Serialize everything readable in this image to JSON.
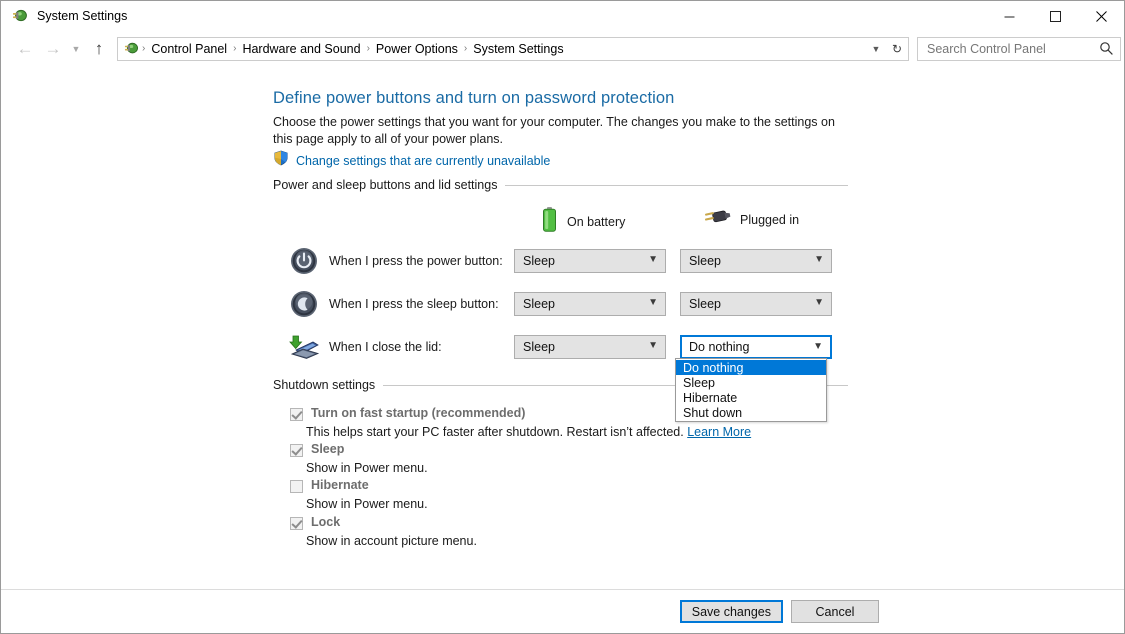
{
  "window": {
    "title": "System Settings",
    "icon": "power-plug-icon",
    "minimize_label": "Minimize",
    "maximize_label": "Maximize",
    "close_label": "Close"
  },
  "nav": {
    "back_label": "Back",
    "forward_label": "Forward",
    "recent_label": "Recent locations",
    "up_label": "Up",
    "breadcrumbs": [
      {
        "label": "Control Panel"
      },
      {
        "label": "Hardware and Sound"
      },
      {
        "label": "Power Options"
      },
      {
        "label": "System Settings"
      }
    ],
    "separator": "›",
    "refresh_label": "Refresh",
    "dropdown_label": "Previous locations"
  },
  "search": {
    "placeholder": "Search Control Panel",
    "value": "",
    "icon": "search-icon"
  },
  "page": {
    "title": "Define power buttons and turn on password protection",
    "description": "Choose the power settings that you want for your computer. The changes you make to the settings on this page apply to all of your power plans.",
    "uac_link": "Change settings that are currently unavailable",
    "uac_icon": "shield-icon"
  },
  "power_section": {
    "header": "Power and sleep buttons and lid settings",
    "columns": [
      {
        "label": "On battery",
        "icon": "battery-icon"
      },
      {
        "label": "Plugged in",
        "icon": "plug-icon"
      }
    ],
    "rows": [
      {
        "icon": "power-button-icon",
        "label": "When I press the power button:",
        "on_battery": "Sleep",
        "plugged_in": "Sleep"
      },
      {
        "icon": "sleep-button-icon",
        "label": "When I press the sleep button:",
        "on_battery": "Sleep",
        "plugged_in": "Sleep"
      },
      {
        "icon": "laptop-lid-icon",
        "label": "When I close the lid:",
        "on_battery": "Sleep",
        "plugged_in": "Do nothing"
      }
    ]
  },
  "dropdown": {
    "open": true,
    "selected": "Do nothing",
    "options": [
      {
        "label": "Do nothing"
      },
      {
        "label": "Sleep"
      },
      {
        "label": "Hibernate"
      },
      {
        "label": "Shut down"
      }
    ]
  },
  "shutdown_section": {
    "header": "Shutdown settings",
    "items": [
      {
        "label": "Turn on fast startup (recommended)",
        "checked": true,
        "description": "This helps start your PC faster after shutdown. Restart isn’t affected.",
        "link": "Learn More"
      },
      {
        "label": "Sleep",
        "checked": true,
        "description": "Show in Power menu.",
        "link": ""
      },
      {
        "label": "Hibernate",
        "checked": false,
        "description": "Show in Power menu.",
        "link": ""
      },
      {
        "label": "Lock",
        "checked": true,
        "description": "Show in account picture menu.",
        "link": ""
      }
    ]
  },
  "footer": {
    "save_label": "Save changes",
    "cancel_label": "Cancel"
  },
  "colors": {
    "accent": "#0078d7",
    "heading": "#1a6ba5",
    "link": "#0066aa",
    "battery": "#46b646",
    "disabled_text": "#6d6d6d"
  }
}
